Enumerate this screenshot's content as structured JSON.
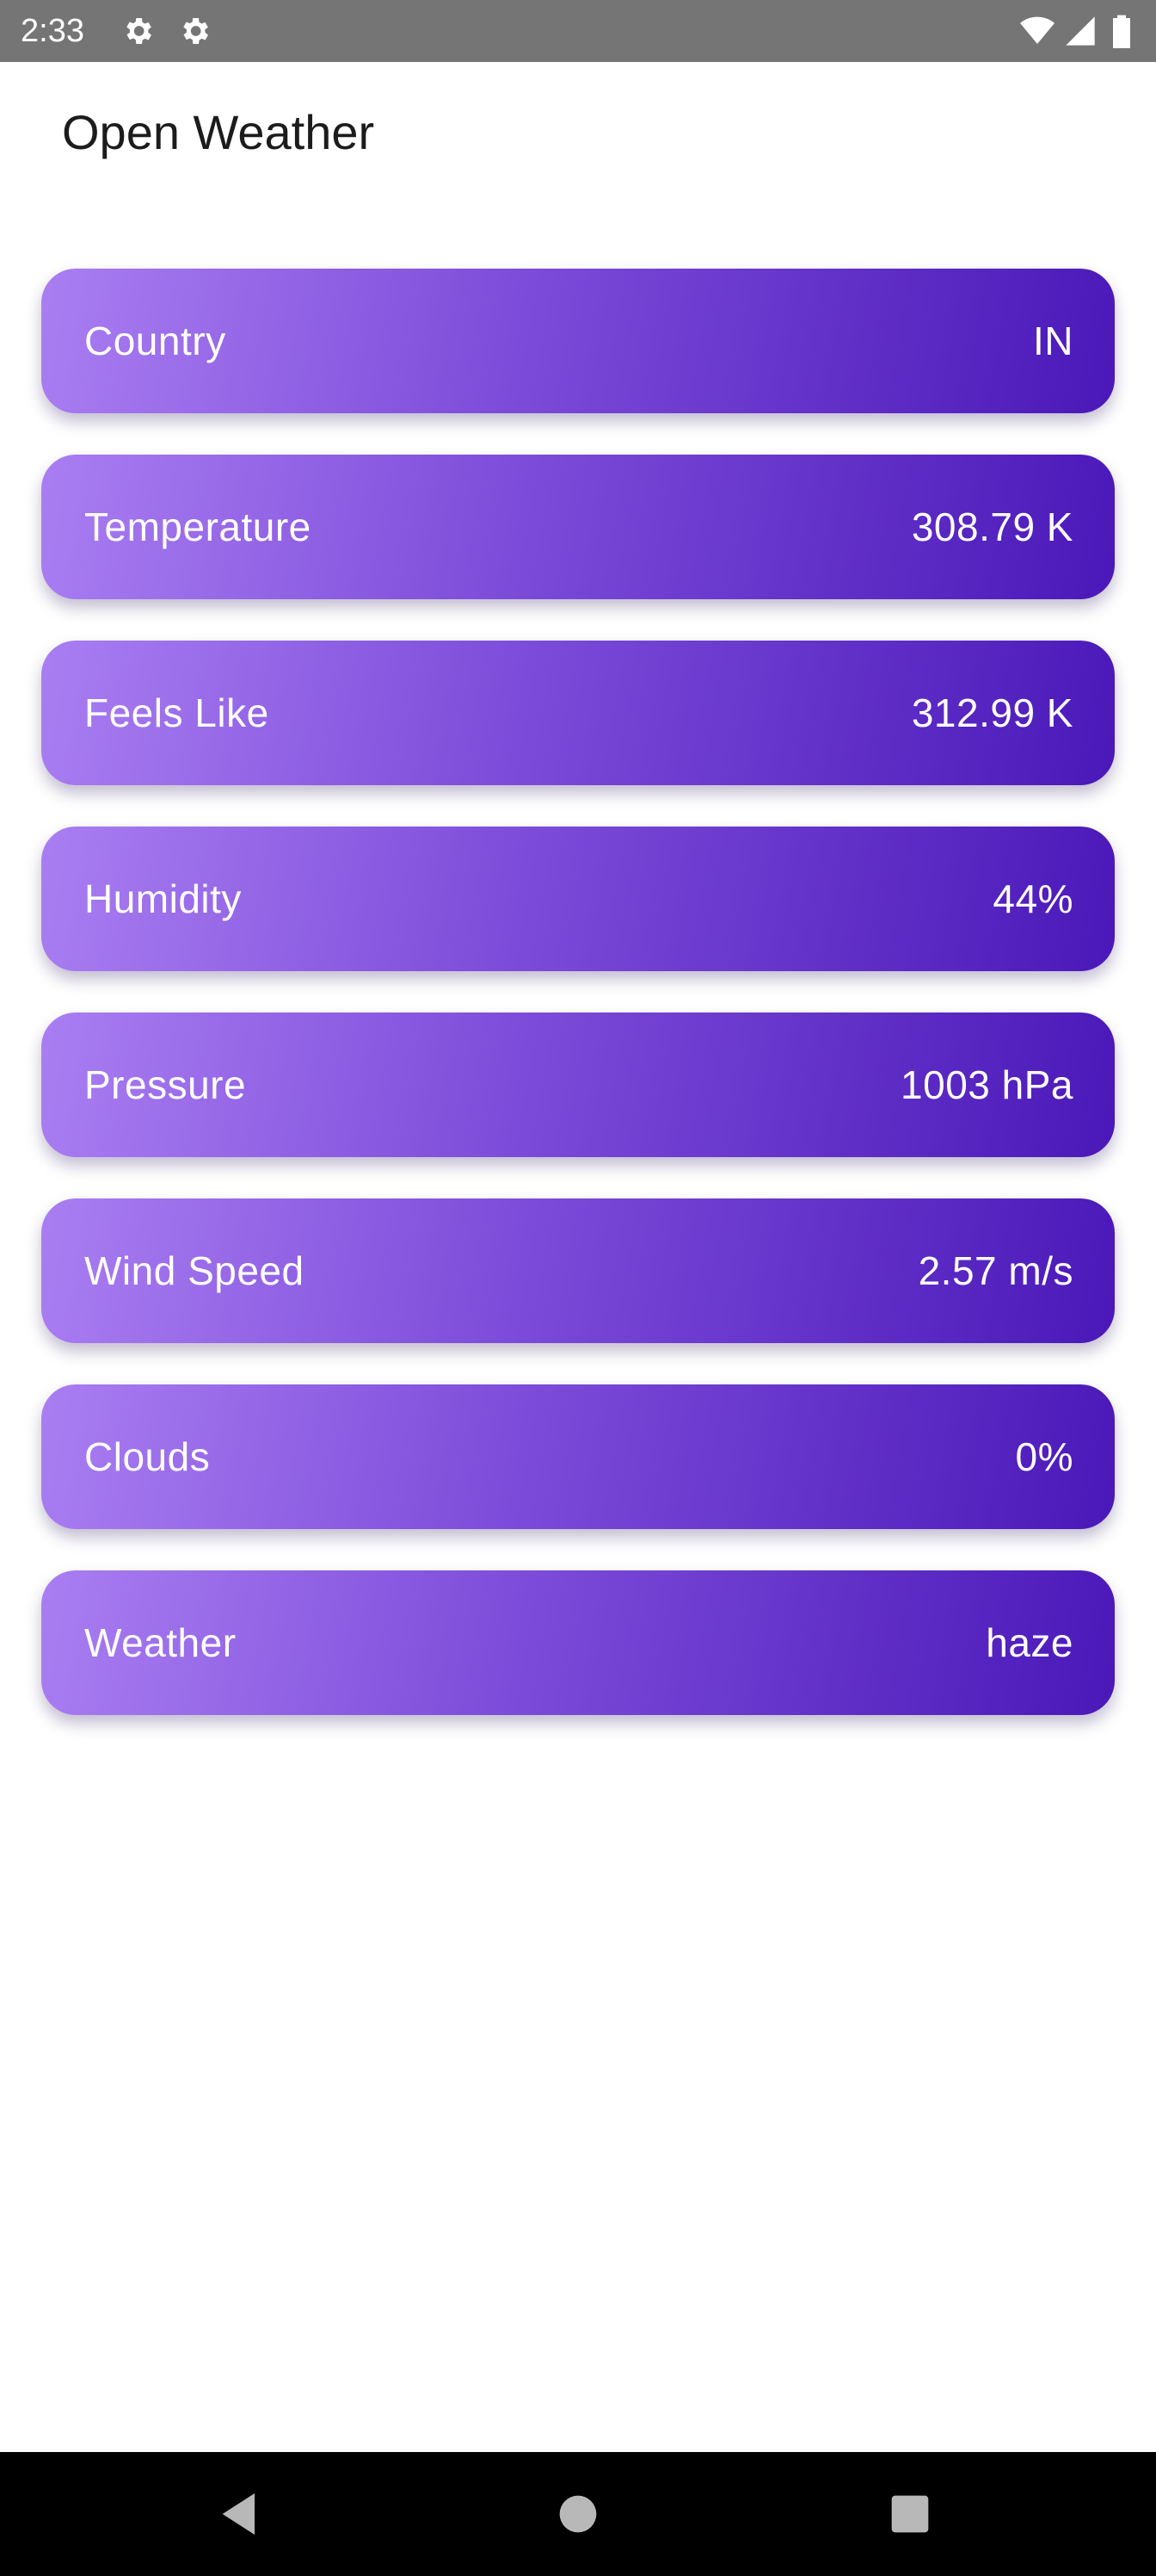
{
  "status_bar": {
    "time": "2:33",
    "left_icons": [
      "gear-icon",
      "gear-icon"
    ],
    "right_icons": [
      "wifi-icon",
      "signal-icon",
      "battery-icon"
    ]
  },
  "app": {
    "title": "Open Weather"
  },
  "weather": {
    "items": [
      {
        "label": "Country",
        "value": "IN"
      },
      {
        "label": "Temperature",
        "value": "308.79 K"
      },
      {
        "label": "Feels Like",
        "value": "312.99 K"
      },
      {
        "label": "Humidity",
        "value": "44%"
      },
      {
        "label": "Pressure",
        "value": "1003 hPa"
      },
      {
        "label": "Wind Speed",
        "value": "2.57 m/s"
      },
      {
        "label": "Clouds",
        "value": "0%"
      },
      {
        "label": "Weather",
        "value": "haze"
      }
    ]
  },
  "nav_bar": {
    "buttons": [
      "back-icon",
      "home-icon",
      "recents-icon"
    ]
  },
  "colors": {
    "status_bar": "#757575",
    "card_gradient_start": "#aa7ef2",
    "card_gradient_end": "#4a18b8",
    "title_text": "#1c1c1c",
    "nav_bar": "#000000"
  }
}
